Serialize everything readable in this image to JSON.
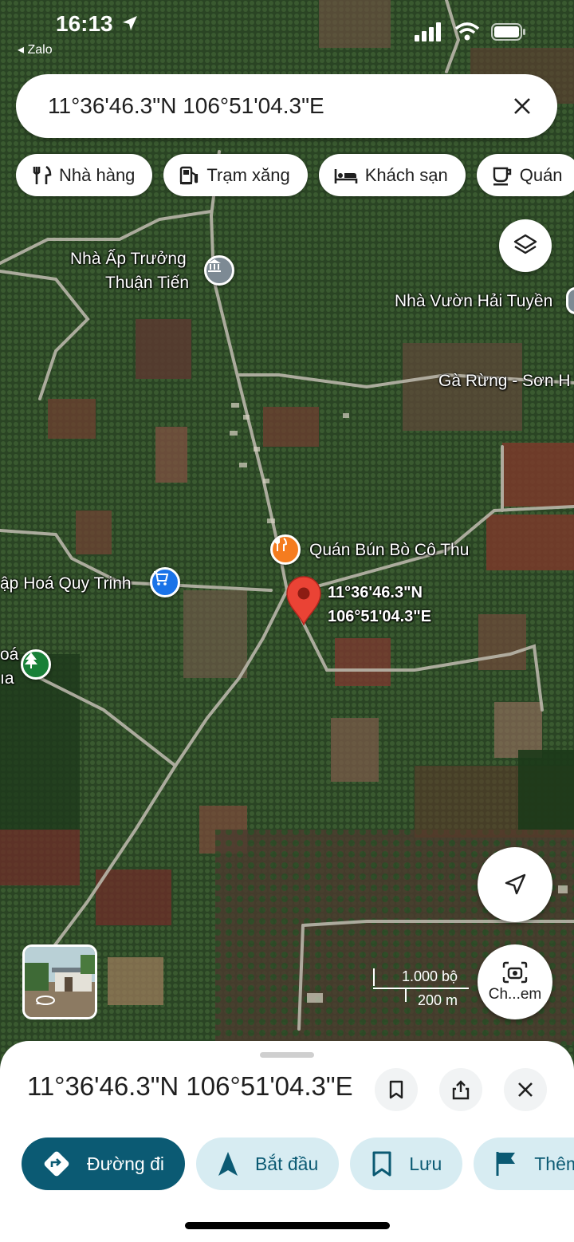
{
  "status_bar": {
    "time": "16:13",
    "back_app": "◂ Zalo"
  },
  "search": {
    "query": "11°36'46.3\"N 106°51'04.3\"E"
  },
  "chips": [
    {
      "icon": "fork-knife-icon",
      "label": "Nhà hàng"
    },
    {
      "icon": "gas-pump-icon",
      "label": "Trạm xăng"
    },
    {
      "icon": "bed-icon",
      "label": "Khách sạn"
    },
    {
      "icon": "coffee-cup-icon",
      "label": "Quán"
    }
  ],
  "map": {
    "labels": {
      "nha_ap_1": "Nhà Ấp Trưởng",
      "nha_ap_2": "Thuận Tiến",
      "nha_vuon": "Nhà Vườn Hải Tuyền",
      "ga_rung": "Gà Rừng - Sơn H",
      "quan_bun_bo": "Quán Bún Bò Cô Thu",
      "tap_hoa": "ập Hoá Quy Trinh",
      "pin_lat": "11°36'46.3\"N",
      "pin_lng": "106°51'04.3\"E",
      "partial_1": "oá",
      "partial_2": "ıa"
    },
    "scale": {
      "feet": "1.000 bộ",
      "meters": "200 m"
    },
    "camera_label": "Ch...em"
  },
  "sheet": {
    "title": "11°36'46.3\"N 106°51'04.3\"E",
    "actions": [
      {
        "icon": "directions-icon",
        "label": "Đường đi"
      },
      {
        "icon": "navigation-arrow-icon",
        "label": "Bắt đầu"
      },
      {
        "icon": "bookmark-icon",
        "label": "Lưu"
      },
      {
        "icon": "flag-icon",
        "label": "Thêm"
      }
    ]
  },
  "colors": {
    "accent": "#0b5a73",
    "accent_soft": "#d7ecf2",
    "pin": "#ea4335",
    "restaurant": "#f57c1f",
    "shop": "#1a73e8",
    "park": "#188038"
  }
}
